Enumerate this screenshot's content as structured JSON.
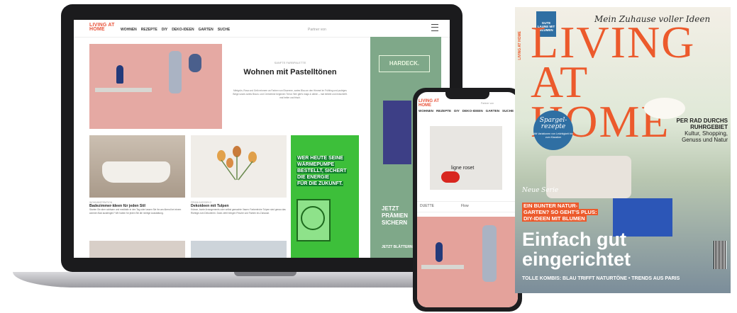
{
  "laptop": {
    "site": {
      "logo": "LIVING AT HOME",
      "nav": [
        "WOHNEN",
        "REZEPTE",
        "DIY",
        "DEKO-IDEEN",
        "GARTEN",
        "SUCHE"
      ],
      "partner": "Partner von"
    },
    "hero": {
      "tag": "SANFTE FARBPALETTE",
      "title": "Wohnen mit Pastelltönen",
      "body": "Mintgrün, Rosa und Gelb erinnern an Farben von Eiscreme, zartes Blau an den Himmel im Frühling und pudriges Beige sowie zartes Braun- und Cremetöne beginnen Trend. Wer gibt's mags & alleen – mal beliebt und entschleift. mal heiter und frisch."
    },
    "cards": [
      {
        "tag": "WOHNINSPIRATION",
        "title": "Badezimmer-Ideen für jeden Stil",
        "body": "Starten Sie aber achtsam und meditativ in den Tag oder lassen Sie ihn am Abend bei einem warmen Bad ausklingen? Wir haben für jeden Stil die richtige Ausstattung."
      },
      {
        "tag": "FRÜHLINGSDEKO",
        "title": "Dekoideen mit Tulpen",
        "body": "Kränze, bunte Arrangements oder selbst gemachte Vasen: Farbenfrohe Tulpen sind genau das Richtige zum Dekorieren. Dann zieht bringen Frische und Farben ins Zuhause."
      }
    ],
    "ad_green": {
      "line1": "WER HEUTE SEINE",
      "line2": "WÄRMEPUMPE",
      "line3": "BESTELLT, SICHERT",
      "line4": "DIE ENERGIE",
      "line5": "FÜR DIE ZUKUNFT."
    },
    "side_ad": {
      "brand": "HARDECK.",
      "line1": "JETZT",
      "line2": "PRÄMIEN",
      "line3": "SICHERN",
      "button": "JETZT BLÄTTERN"
    }
  },
  "phone": {
    "logo": "LIVING AT HOME",
    "nav": [
      "WOHNEN",
      "REZEPTE",
      "DIY",
      "DEKO-IDEEN",
      "GARTEN",
      "SUCHE"
    ],
    "partner": "Partner von",
    "brand_in_image": "ligne roset",
    "bar_left": "DUETTE",
    "bar_right": "Flow"
  },
  "magazine": {
    "tagline": "Mein Zuhause voller Ideen",
    "logo_line1": "LIVING",
    "logo_line2": "AT HOME",
    "side": "LIVING AT HOME",
    "badge": "GUTE LAUNE MIT BLUMEN",
    "circle_title1": "Spargel-",
    "circle_title2": "rezepte",
    "circle_sub": "Mit Variationen von Leichtigkeit bis zum Klassiker",
    "right1": "PER RAD DURCHS",
    "right2": "RUHRGEBIET",
    "right3": "Kultur, Shopping,",
    "right4": "Genuss und Natur",
    "series": "Neue Serie",
    "orange1": "EIN BUNTER NATUR-",
    "orange2": "GARTEN? SO GEHT'S PLUS:",
    "orange3": "DIY-IDEEN MIT BLUMEN",
    "headline1": "Einfach gut",
    "headline2": "eingerichtet",
    "footer": "TOLLE KOMBIS: BLAU TRIFFT NATURTÖNE • TRENDS AUS PARIS"
  }
}
